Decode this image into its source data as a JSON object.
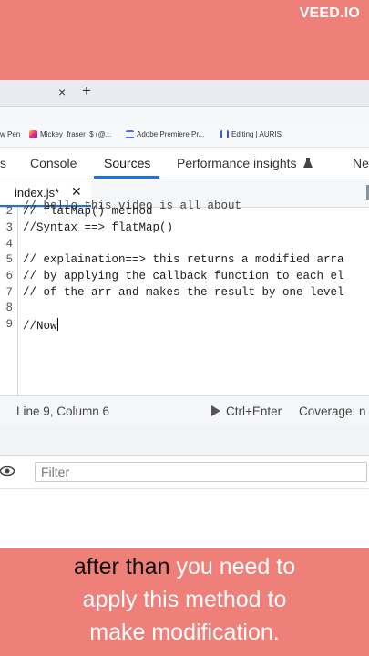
{
  "watermark": "VEED.IO",
  "browser": {
    "tab_close": "×",
    "new_tab": "+",
    "bookmarks": [
      {
        "label": "w Pen",
        "icon": "none"
      },
      {
        "label": "Mickey_fraser_$ (@...",
        "icon": "instagram-icon",
        "color": "#d6249f"
      },
      {
        "label": "Adobe Premiere Pr...",
        "icon": "adobe-icon",
        "color": "#4a6cf7"
      },
      {
        "label": "Editing | AURIS",
        "icon": "auris-icon",
        "color": "#3b5bdb"
      }
    ]
  },
  "devtools": {
    "tabs": [
      {
        "label": "s"
      },
      {
        "label": "Console"
      },
      {
        "label": "Sources",
        "active": true
      },
      {
        "label": "Performance insights"
      },
      {
        "label": "Ne"
      }
    ],
    "file_tab": {
      "name": "index.js*",
      "close": "✕"
    },
    "editor": {
      "cut_line": "// hello this video is all about",
      "lines": [
        {
          "n": "2",
          "text": "// flatMap() method"
        },
        {
          "n": "3",
          "text": "//Syntax ==> flatMap()"
        },
        {
          "n": "4",
          "text": ""
        },
        {
          "n": "5",
          "text": "// explaination==> this returns a modified arra"
        },
        {
          "n": "6",
          "text": "// by applying the callback function to each el"
        },
        {
          "n": "7",
          "text": "// of the arr and makes the result by one level"
        },
        {
          "n": "8",
          "text": ""
        },
        {
          "n": "9",
          "text": "//Now"
        }
      ]
    },
    "status": {
      "position": "Line 9, Column 6",
      "run": "Ctrl+Enter",
      "coverage": "Coverage: n"
    },
    "filter_placeholder": "Filter"
  },
  "caption": {
    "highlight": "after than",
    "rest_line1": " you need to",
    "line2": "apply this method to",
    "line3": "make modification."
  }
}
